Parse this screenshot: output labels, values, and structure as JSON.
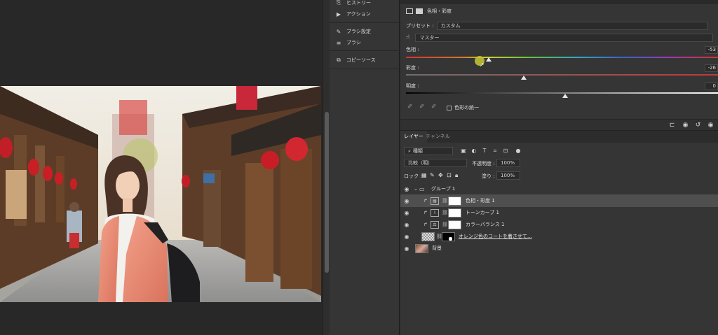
{
  "left_panels": {
    "items": [
      {
        "label": "ヒストリー",
        "icon": "history-icon"
      },
      {
        "label": "アクション",
        "icon": "play-icon"
      },
      {
        "label": "ブラシ設定",
        "icon": "brush-settings-icon"
      },
      {
        "label": "ブラシ",
        "icon": "brush-icon"
      },
      {
        "label": "コピーソース",
        "icon": "clone-source-icon"
      }
    ]
  },
  "properties": {
    "title": "色相・彩度",
    "preset_label": "プリセット :",
    "preset_value": "カスタム",
    "channel_value": "マスター",
    "hue_label": "色相 :",
    "hue_value": "-53",
    "saturation_label": "彩度 :",
    "saturation_value": "-26",
    "lightness_label": "明度 :",
    "lightness_value": "0",
    "colorize_label": "色彩の統一"
  },
  "layers": {
    "tab_layers": "レイヤー",
    "tab_channels": "チャンネル",
    "filter_kind": "種類",
    "blend_mode": "比較（明）",
    "opacity_label": "不透明度 :",
    "opacity_value": "100%",
    "lock_label": "ロック :",
    "fill_label": "塗り :",
    "fill_value": "100%",
    "rows": [
      {
        "name": "グループ 1",
        "type": "group"
      },
      {
        "name": "色相・彩度 1",
        "type": "adjustment",
        "icon": "hue-saturation-icon"
      },
      {
        "name": "トーンカーブ 1",
        "type": "adjustment",
        "icon": "curves-icon"
      },
      {
        "name": "カラーバランス 1",
        "type": "adjustment",
        "icon": "color-balance-icon"
      },
      {
        "name": "オレンジ色のコートを着させて...",
        "type": "pixel"
      },
      {
        "name": "背景",
        "type": "background"
      }
    ]
  },
  "colors": {
    "panel_bg": "#353535",
    "app_bg": "#282828",
    "selected_row": "#4f4f4f",
    "hue_handle": "#c9c733"
  }
}
